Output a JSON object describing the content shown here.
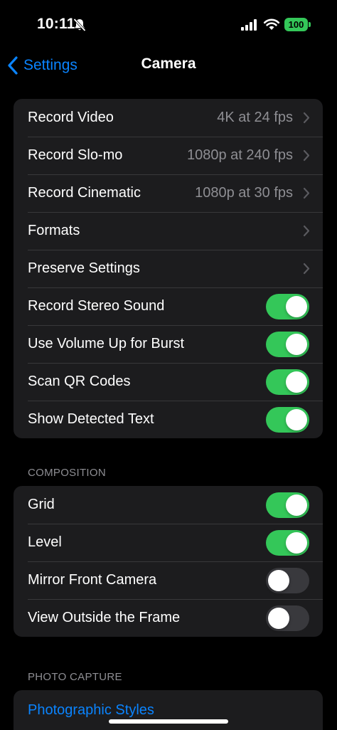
{
  "status_bar": {
    "time": "10:11",
    "battery": "100",
    "icons": [
      "bell-slash-icon",
      "signal-icon",
      "wifi-icon",
      "battery-icon"
    ],
    "battery_color": "#34c759"
  },
  "nav": {
    "back_label": "Settings",
    "title": "Camera",
    "accent_color": "#0a84ff"
  },
  "main_group": {
    "rows": [
      {
        "label": "Record Video",
        "value": "4K at 24 fps"
      },
      {
        "label": "Record Slo-mo",
        "value": "1080p at 240 fps"
      },
      {
        "label": "Record Cinematic",
        "value": "1080p at 30 fps"
      },
      {
        "label": "Formats",
        "value": ""
      },
      {
        "label": "Preserve Settings",
        "value": ""
      },
      {
        "label": "Record Stereo Sound",
        "toggle": true
      },
      {
        "label": "Use Volume Up for Burst",
        "toggle": true
      },
      {
        "label": "Scan QR Codes",
        "toggle": true
      },
      {
        "label": "Show Detected Text",
        "toggle": true
      }
    ]
  },
  "composition": {
    "header": "COMPOSITION",
    "rows": [
      {
        "label": "Grid",
        "toggle": true
      },
      {
        "label": "Level",
        "toggle": true
      },
      {
        "label": "Mirror Front Camera",
        "toggle": false
      },
      {
        "label": "View Outside the Frame",
        "toggle": false
      }
    ]
  },
  "photo_capture": {
    "header": "PHOTO CAPTURE",
    "link_label": "Photographic Styles"
  },
  "colors": {
    "toggle_on": "#34c759",
    "toggle_off": "#39393d",
    "group_bg": "#1c1c1e"
  }
}
